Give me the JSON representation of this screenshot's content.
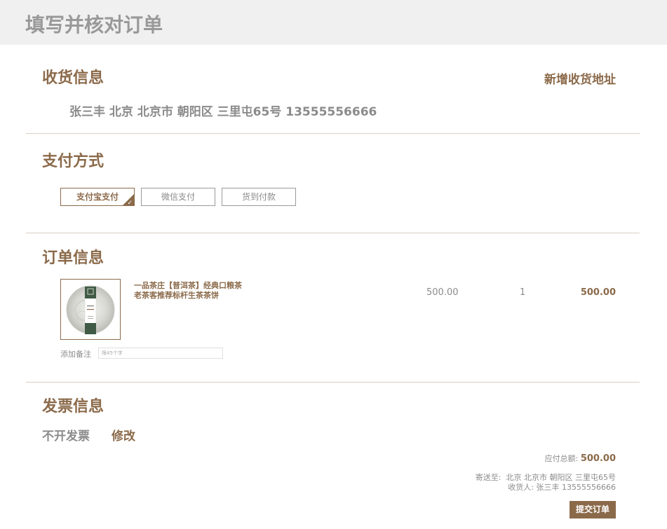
{
  "page": {
    "title": "填写并核对订单"
  },
  "shipping": {
    "section_title": "收货信息",
    "add_address_label": "新增收货地址",
    "address_line": "张三丰 北京 北京市 朝阳区 三里屯65号 13555556666"
  },
  "payment": {
    "section_title": "支付方式",
    "options": [
      "支付宝支付",
      "微信支付",
      "货到付款"
    ],
    "selected": "支付宝支付",
    "selected_check_icon": "check-icon"
  },
  "order": {
    "section_title": "订单信息",
    "items": [
      {
        "name_line1": "一品茶庄【普洱茶】经典口粮茶",
        "name_line2": "老茶客推荐标杆生茶茶饼",
        "price": "500.00",
        "quantity": "1",
        "subtotal": "500.00",
        "image_icon": "tea-cake-icon"
      }
    ],
    "remark_label": "添加备注",
    "remark_placeholder": "限45个字"
  },
  "invoice": {
    "section_title": "发票信息",
    "status": "不开发票",
    "edit_label": "修改"
  },
  "summary": {
    "total_label": "应付总额:",
    "total_value": "500.00",
    "ship_to_label": "寄送至:",
    "ship_to_value": "北京 北京市 朝阳区 三里屯65号",
    "receiver_label": "收货人:",
    "receiver_value": "张三丰 13555556666"
  },
  "submit": {
    "label": "提交订单"
  },
  "colors": {
    "brand": "#8b6a4a",
    "muted_text": "#8b8b8b",
    "header_bg": "#f0f0f0",
    "divider": "#d9cfc6"
  }
}
